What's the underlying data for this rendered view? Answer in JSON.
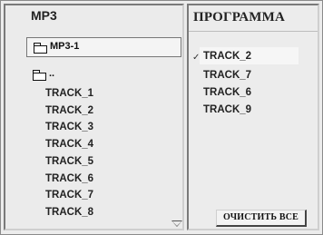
{
  "mp3_panel": {
    "title": "MP3",
    "current_folder": "MP3-1",
    "parent_folder": "..",
    "tracks": [
      "TRACK_1",
      "TRACK_2",
      "TRACK_3",
      "TRACK_4",
      "TRACK_5",
      "TRACK_6",
      "TRACK_7",
      "TRACK_8"
    ]
  },
  "program_panel": {
    "title": "ПРОГРАММА",
    "selected_mark": "✓",
    "items": [
      "TRACK_2",
      "TRACK_7",
      "TRACK_6",
      "TRACK_9"
    ],
    "clear_button_label": "ОЧИСТИТЬ ВСЕ"
  },
  "icons": {
    "folder": "folder-icon",
    "scroll_down": "triangle-down-icon"
  }
}
